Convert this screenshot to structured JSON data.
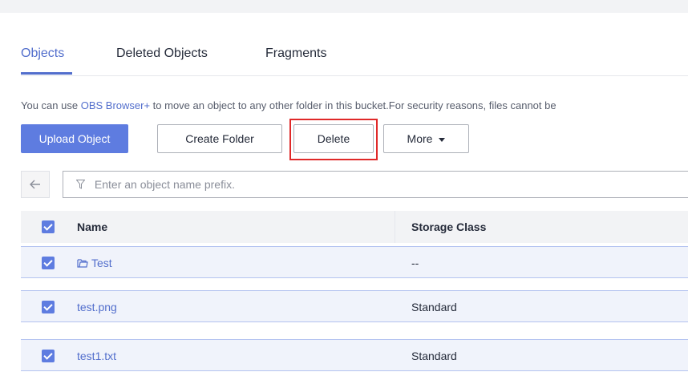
{
  "tabs": {
    "items": [
      {
        "label": "Objects",
        "active": true
      },
      {
        "label": "Deleted Objects",
        "active": false
      },
      {
        "label": "Fragments",
        "active": false
      }
    ]
  },
  "notice": {
    "prefix": "You can use ",
    "link": "OBS Browser+",
    "suffix": " to move an object to any other folder in this bucket.For security reasons, files cannot be"
  },
  "toolbar": {
    "upload_label": "Upload Object",
    "create_folder_label": "Create Folder",
    "delete_label": "Delete",
    "more_label": "More"
  },
  "search": {
    "placeholder": "Enter an object name prefix."
  },
  "table": {
    "columns": [
      "Name",
      "Storage Class"
    ],
    "rows": [
      {
        "name": "Test",
        "storage_class": "--",
        "type": "folder",
        "checked": true
      },
      {
        "name": "test.png",
        "storage_class": "Standard",
        "type": "file",
        "checked": true
      },
      {
        "name": "test1.txt",
        "storage_class": "Standard",
        "type": "file",
        "checked": true
      }
    ]
  },
  "colors": {
    "accent": "#526ecc",
    "primary_button": "#5e7ce0",
    "highlight": "#e02929",
    "selected_row": "#f0f3fb"
  }
}
